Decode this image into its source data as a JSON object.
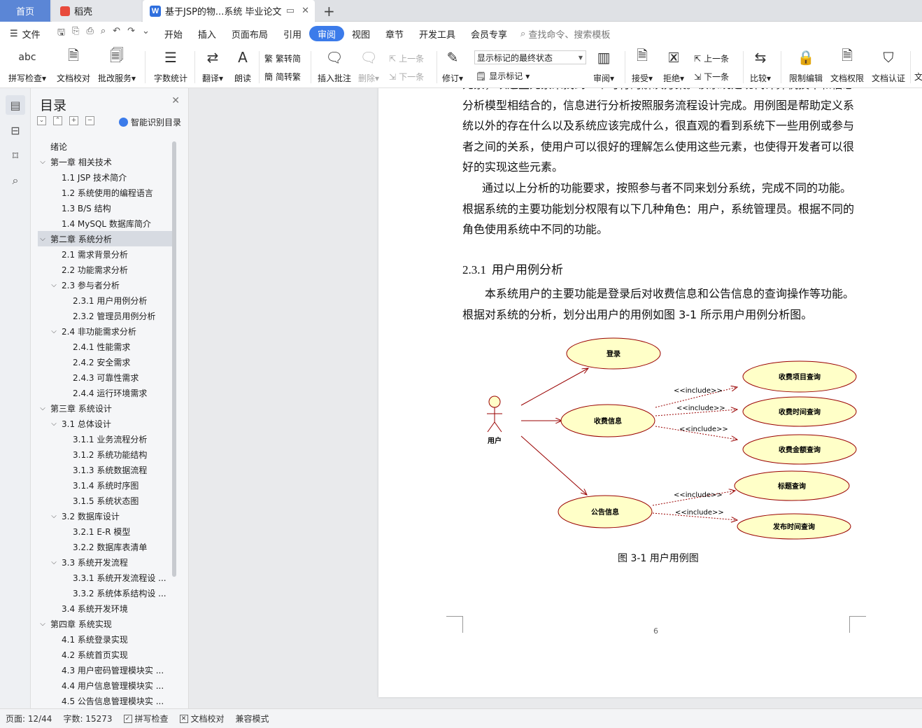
{
  "tabs": {
    "home": "首页",
    "daoke": "稻壳",
    "doc": "基于JSP的物...系统 毕业论文"
  },
  "menu": {
    "file": "文件",
    "items": [
      "开始",
      "插入",
      "页面布局",
      "引用",
      "审阅",
      "视图",
      "章节",
      "开发工具",
      "会员专享"
    ],
    "active": "审阅",
    "search": "查找命令、搜索模板"
  },
  "ribbon": {
    "spell": "拼写检查",
    "proof": "文档校对",
    "batch": "批改服务",
    "wordcount": "字数统计",
    "translate": "翻译",
    "read": "朗读",
    "trad2simp": "繁转简",
    "simp2trad": "简转繁",
    "insert_comment": "插入批注",
    "delete": "删除",
    "prev": "上一条",
    "next": "下一条",
    "revise": "修订",
    "markup_state": "显示标记的最终状态",
    "show_markup": "显示标记",
    "review": "审阅",
    "accept": "接受",
    "reject": "拒绝",
    "prev2": "上一条",
    "next2": "下一条",
    "compare": "比较",
    "restrict": "限制编辑",
    "doc_rights": "文档权限",
    "doc_cert": "文档认证",
    "more": "文"
  },
  "toc": {
    "title": "目录",
    "smart": "智能识别目录",
    "items": [
      {
        "label": "绪论",
        "level": 0,
        "caret": ""
      },
      {
        "label": "第一章  相关技术",
        "level": 0,
        "caret": "v"
      },
      {
        "label": "1.1 JSP 技术简介",
        "level": 1,
        "caret": ""
      },
      {
        "label": "1.2  系统使用的编程语言",
        "level": 1,
        "caret": ""
      },
      {
        "label": "1.3 B/S 结构",
        "level": 1,
        "caret": ""
      },
      {
        "label": "1.4 MySQL 数据库简介",
        "level": 1,
        "caret": ""
      },
      {
        "label": "第二章  系统分析",
        "level": 0,
        "caret": "v",
        "selected": true
      },
      {
        "label": "2.1  需求背景分析",
        "level": 1,
        "caret": ""
      },
      {
        "label": "2.2  功能需求分析",
        "level": 1,
        "caret": ""
      },
      {
        "label": "2.3  参与者分析",
        "level": 1,
        "caret": "v"
      },
      {
        "label": "2.3.1  用户用例分析",
        "level": 2,
        "caret": ""
      },
      {
        "label": "2.3.2  管理员用例分析",
        "level": 2,
        "caret": ""
      },
      {
        "label": "2.4  非功能需求分析",
        "level": 1,
        "caret": "v"
      },
      {
        "label": "2.4.1  性能需求",
        "level": 2,
        "caret": ""
      },
      {
        "label": "2.4.2  安全需求",
        "level": 2,
        "caret": ""
      },
      {
        "label": "2.4.3  可靠性需求",
        "level": 2,
        "caret": ""
      },
      {
        "label": "2.4.4  运行环境需求",
        "level": 2,
        "caret": ""
      },
      {
        "label": "第三章  系统设计",
        "level": 0,
        "caret": "v"
      },
      {
        "label": "3.1  总体设计",
        "level": 1,
        "caret": "v"
      },
      {
        "label": "3.1.1  业务流程分析",
        "level": 2,
        "caret": ""
      },
      {
        "label": "3.1.2  系统功能结构",
        "level": 2,
        "caret": ""
      },
      {
        "label": "3.1.3  系统数据流程",
        "level": 2,
        "caret": ""
      },
      {
        "label": "3.1.4  系统时序图",
        "level": 2,
        "caret": ""
      },
      {
        "label": "3.1.5  系统状态图",
        "level": 2,
        "caret": ""
      },
      {
        "label": "3.2  数据库设计",
        "level": 1,
        "caret": "v"
      },
      {
        "label": "3.2.1 E-R 模型",
        "level": 2,
        "caret": ""
      },
      {
        "label": "3.2.2  数据库表清单",
        "level": 2,
        "caret": ""
      },
      {
        "label": "3.3  系统开发流程",
        "level": 1,
        "caret": "v"
      },
      {
        "label": "3.3.1  系统开发流程设 ...",
        "level": 2,
        "caret": ""
      },
      {
        "label": "3.3.2  系统体系结构设 ...",
        "level": 2,
        "caret": ""
      },
      {
        "label": "3.4  系统开发环境",
        "level": 1,
        "caret": ""
      },
      {
        "label": "第四章  系统实现",
        "level": 0,
        "caret": "v"
      },
      {
        "label": "4.1  系统登录实现",
        "level": 1,
        "caret": ""
      },
      {
        "label": "4.2  系统首页实现",
        "level": 1,
        "caret": ""
      },
      {
        "label": "4.3  用户密码管理模块实 ...",
        "level": 1,
        "caret": ""
      },
      {
        "label": "4.4  用户信息管理模块实 ...",
        "level": 1,
        "caret": ""
      },
      {
        "label": "4.5  公告信息管理模块实 ...",
        "level": 1,
        "caret": ""
      }
    ]
  },
  "doc": {
    "p1": [
      "元素，以这些元素来找到一个可行的解决方案。该系统是现代计算机技术和信息",
      "分析模型相结合的，信息进行分析按照服务流程设计完成。用例图是帮助定义系",
      "统以外的存在什么以及系统应该完成什么，很直观的看到系统下一些用例或参与",
      "者之间的关系，使用户可以很好的理解怎么使用这些元素，也使得开发者可以很",
      "好的实现这些元素。"
    ],
    "p2": [
      "通过以上分析的功能要求，按照参与者不同来划分系统，完成不同的功能。",
      "根据系统的主要功能划分权限有以下几种角色：用户，系统管理员。根据不同的",
      "角色使用系统中不同的功能。"
    ],
    "heading_num": "2.3.1",
    "heading_text": "用户用例分析",
    "p3": [
      "本系统用户的主要功能是登录后对收费信息和公告信息的查询操作等功能。",
      "根据对系统的分析，划分出用户的用例如图 3-1 所示用户用例分析图。"
    ],
    "caption": "图 3-1 用户用例图",
    "page_number": "6"
  },
  "diagram": {
    "actor": "用户",
    "login": "登录",
    "fee": "收费信息",
    "notice": "公告信息",
    "fee_item": "收费项目查询",
    "fee_time": "收费时间查询",
    "fee_amount": "收费金额查询",
    "title_q": "标题查询",
    "pub_time": "发布时间查询",
    "include": "<<include>>",
    "colors": {
      "ellipse_fill": "#ffffc8",
      "ellipse_stroke": "#990000",
      "arrow": "#990000"
    }
  },
  "status": {
    "page": "页面: 12/44",
    "words": "字数: 15273",
    "spell": "拼写检查",
    "proof": "文档校对",
    "compat": "兼容模式"
  }
}
